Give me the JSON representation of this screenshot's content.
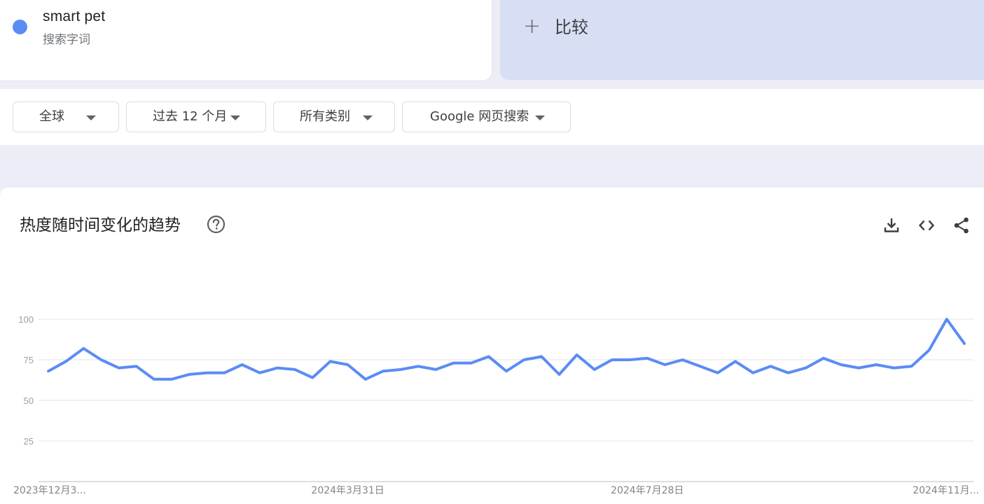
{
  "term": {
    "name": "smart pet",
    "subtitle": "搜索字词",
    "color": "#5b8cf5"
  },
  "compare": {
    "plus": "+",
    "label": "比较"
  },
  "filters": [
    {
      "label": "全球"
    },
    {
      "label": "过去 12 个月"
    },
    {
      "label": "所有类别"
    },
    {
      "label": "Google 网页搜索"
    }
  ],
  "chart_header": {
    "title": "热度随时间变化的趋势",
    "icons": [
      "help-icon",
      "download-icon",
      "embed-code-icon",
      "share-icon"
    ]
  },
  "chart_data": {
    "type": "line",
    "title": "热度随时间变化的趋势",
    "xlabel": "",
    "ylabel": "",
    "ylim": [
      0,
      100
    ],
    "yticks": [
      25,
      50,
      75,
      100
    ],
    "grid": true,
    "x_tick_labels": [
      "2023年12月3...",
      "2024年3月31日",
      "2024年7月28日",
      "2024年11月..."
    ],
    "x_tick_indices": [
      0,
      17,
      34,
      51
    ],
    "series": [
      {
        "name": "smart pet",
        "color": "#5b8cf5",
        "values": [
          68,
          74,
          82,
          75,
          70,
          71,
          63,
          63,
          66,
          67,
          67,
          72,
          67,
          70,
          69,
          64,
          74,
          72,
          63,
          68,
          69,
          71,
          69,
          73,
          73,
          77,
          68,
          75,
          77,
          66,
          78,
          69,
          75,
          75,
          76,
          72,
          75,
          71,
          67,
          74,
          67,
          71,
          67,
          70,
          76,
          72,
          70,
          72,
          70,
          71,
          81,
          100,
          85
        ]
      }
    ]
  }
}
